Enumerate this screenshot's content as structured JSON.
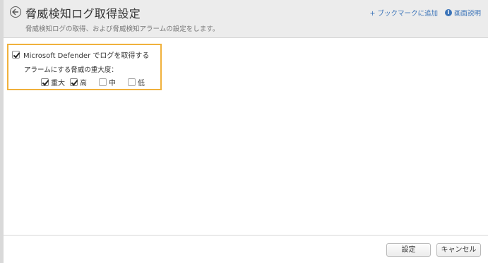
{
  "header": {
    "title": "脅威検知ログ取得設定",
    "subtitle": "脅威検知ログの取得、および脅威検知アラームの設定をします。",
    "bookmark_label": "+ ブックマークに追加",
    "help_label": "画面説明",
    "help_icon_glyph": "i"
  },
  "settings": {
    "defender_label": "Microsoft Defender でログを取得する",
    "defender_checked": true,
    "alarm_label": "アラームにする脅威の重大度：",
    "severities": [
      {
        "label": "重大",
        "checked": true
      },
      {
        "label": "高",
        "checked": true
      },
      {
        "label": "中",
        "checked": false
      },
      {
        "label": "低",
        "checked": false
      }
    ]
  },
  "footer": {
    "save_label": "設定",
    "cancel_label": "キャンセル"
  },
  "colors": {
    "highlight_border": "#f0b13c",
    "link": "#3a73b8",
    "header_bg": "#ececec"
  }
}
